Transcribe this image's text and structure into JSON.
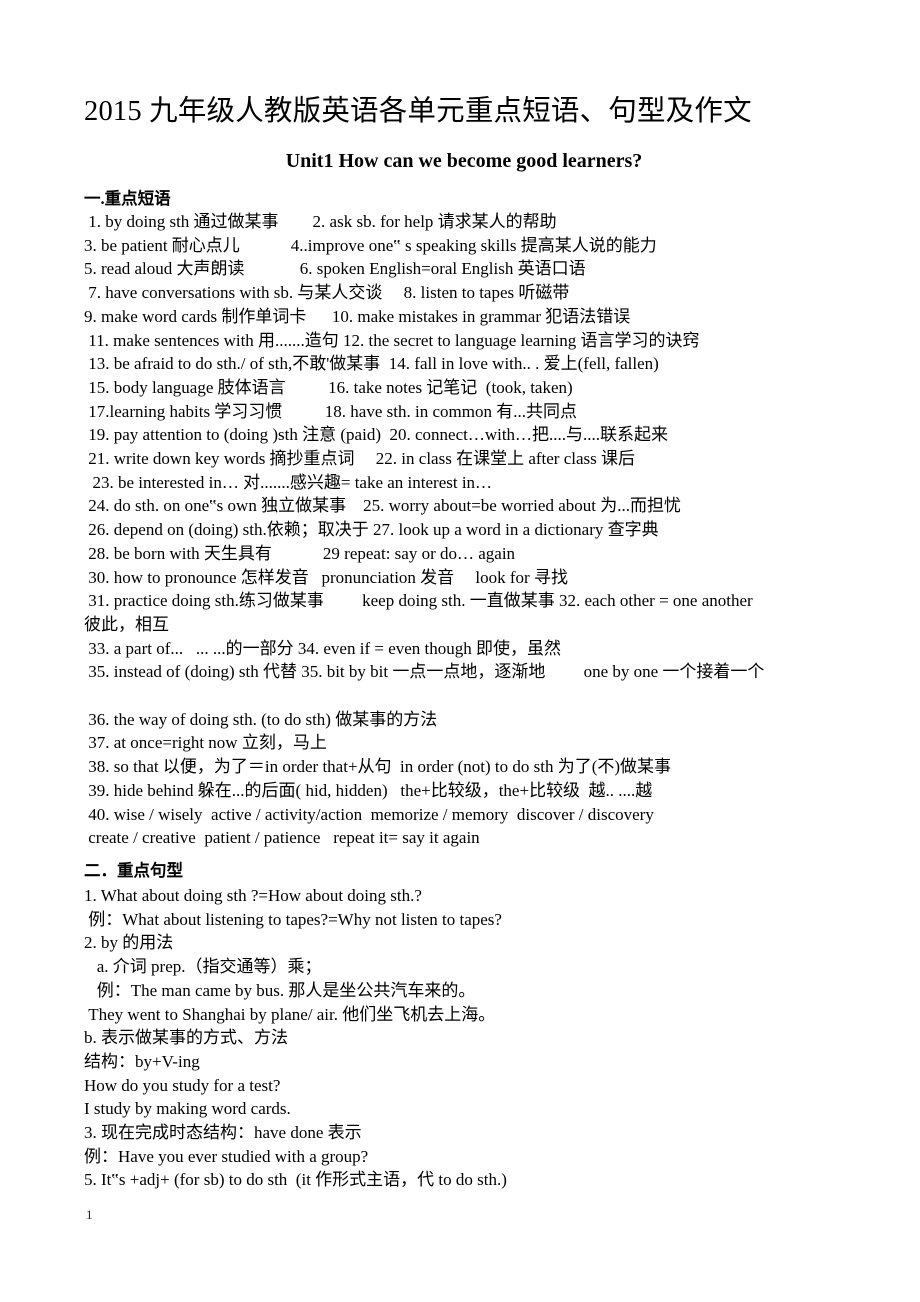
{
  "document": {
    "title": "2015 九年级人教版英语各单元重点短语、句型及作文",
    "unit_heading": "Unit1 How can we become good learners?",
    "page_number": "1"
  },
  "section_one": {
    "heading": "一.重点短语",
    "lines": [
      " 1. by doing sth 通过做某事        2. ask sb. for help 请求某人的帮助",
      "3. be patient 耐心点儿            4..improve one‟ s speaking skills 提高某人说的能力",
      "5. read aloud 大声朗读             6. spoken English=oral English 英语口语",
      " 7. have conversations with sb. 与某人交谈     8. listen to tapes 听磁带",
      "9. make word cards 制作单词卡      10. make mistakes in grammar 犯语法错误",
      " 11. make sentences with 用.......造句 12. the secret to language learning 语言学习的诀窍",
      " 13. be afraid to do sth./ of sth,不敢'做某事  14. fall in love with.. . 爱上(fell, fallen)",
      " 15. body language 肢体语言          16. take notes 记笔记  (took, taken)",
      " 17.learning habits 学习习惯          18. have sth. in common 有...共同点",
      " 19. pay attention to (doing )sth 注意 (paid)  20. connect…with…把....与....联系起来",
      " 21. write down key words 摘抄重点词     22. in class 在课堂上 after class 课后",
      "  23. be interested in… 对.......感兴趣= take an interest in…",
      " 24. do sth. on one‟s own 独立做某事    25. worry about=be worried about 为...而担忧",
      " 26. depend on (doing) sth.依赖；取决于 27. look up a word in a dictionary 查字典",
      " 28. be born with 天生具有            29 repeat: say or do… again",
      " 30. how to pronounce 怎样发音   pronunciation 发音     look for 寻找",
      " 31. practice doing sth.练习做某事         keep doing sth. 一直做某事 32. each other = one another",
      "彼此，相互",
      " 33. a part of...   ... ...的一部分 34. even if = even though 即使，虽然",
      " 35. instead of (doing) sth 代替 35. bit by bit 一点一点地，逐渐地         one by one 一个接着一个",
      "",
      " 36. the way of doing sth. (to do sth) 做某事的方法",
      " 37. at once=right now 立刻，马上",
      " 38. so that 以便，为了＝in order that+从句  in order (not) to do sth 为了(不)做某事",
      " 39. hide behind 躲在...的后面( hid, hidden)   the+比较级，the+比较级  越.. ....越",
      " 40. wise / wisely  active / activity/action  memorize / memory  discover / discovery",
      " create / creative  patient / patience   repeat it= say it again"
    ]
  },
  "section_two": {
    "heading": "二．重点句型",
    "lines": [
      "1. What about doing sth ?=How about doing sth.?",
      " 例：What about listening to tapes?=Why not listen to tapes?",
      "2. by 的用法",
      "   a. 介词 prep.（指交通等）乘；",
      "   例：The man came by bus. 那人是坐公共汽车来的。",
      " They went to Shanghai by plane/ air. 他们坐飞机去上海。",
      "b. 表示做某事的方式、方法",
      "结构：by+V-ing",
      "How do you study for a test?",
      "I study by making word cards.",
      "3. 现在完成时态结构：have done 表示",
      "例：Have you ever studied with a group?",
      "5. It‟s +adj+ (for sb) to do sth  (it 作形式主语，代 to do sth.)"
    ]
  }
}
